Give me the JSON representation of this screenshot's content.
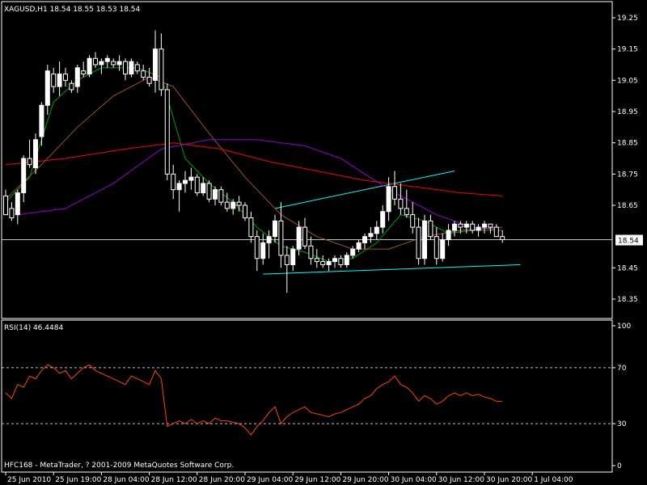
{
  "header": {
    "symbol_info": "XAGUSD,H1  18.54 18.55 18.53 18.54"
  },
  "indicator": {
    "label": "RSI(14) 46.4484"
  },
  "footer": {
    "copyright": "HFC168 - MetaTrader, ? 2001-2009 MetaQuotes Software Corp."
  },
  "current_price_label": "18.54",
  "colors": {
    "background": "#000000",
    "frame": "#ffffff",
    "bull_candle": "#ffffff",
    "bear_candle": "#000000",
    "ma_fast": "#00a000",
    "ma_mid": "#a0522d",
    "ma_slow": "#ff0000",
    "ma_long": "#9400d3",
    "trendline": "#00ffff",
    "rsi_line": "#ff4500",
    "level_line": "#c0c0c0"
  },
  "chart_data": [
    {
      "type": "candlestick",
      "title": "XAGUSD,H1  18.54 18.55 18.53 18.54",
      "ylim": [
        18.3,
        19.3
      ],
      "y_ticks": [
        "19.25",
        "19.15",
        "19.05",
        "18.95",
        "18.85",
        "18.75",
        "18.65",
        "18.54",
        "18.45",
        "18.35"
      ],
      "y_tick_values": [
        19.25,
        19.15,
        19.05,
        18.95,
        18.85,
        18.75,
        18.65,
        18.54,
        18.45,
        18.35
      ],
      "x_ticks": [
        "25 Jun 2010",
        "25 Jun 19:00",
        "28 Jun 04:00",
        "28 Jun 12:00",
        "28 Jun 20:00",
        "29 Jun 04:00",
        "29 Jun 12:00",
        "29 Jun 20:00",
        "30 Jun 04:00",
        "30 Jun 12:00",
        "30 Jun 20:00",
        "1 Jul 04:00"
      ],
      "x_tick_index": [
        0,
        8,
        16,
        24,
        32,
        40,
        48,
        56,
        64,
        72,
        80,
        88
      ],
      "current_price": 18.54,
      "ohlc": [
        [
          18.68,
          18.7,
          18.62,
          18.62
        ],
        [
          18.64,
          18.66,
          18.6,
          18.61
        ],
        [
          18.62,
          18.7,
          18.59,
          18.69
        ],
        [
          18.69,
          18.81,
          18.66,
          18.8
        ],
        [
          18.8,
          18.86,
          18.77,
          18.78
        ],
        [
          18.77,
          18.88,
          18.75,
          18.86
        ],
        [
          18.87,
          18.98,
          18.84,
          18.97
        ],
        [
          18.97,
          19.1,
          18.94,
          19.08
        ],
        [
          19.07,
          19.09,
          19.01,
          19.03
        ],
        [
          19.03,
          19.11,
          19.0,
          19.07
        ],
        [
          19.07,
          19.09,
          19.03,
          19.05
        ],
        [
          19.04,
          19.05,
          19.01,
          19.02
        ],
        [
          19.03,
          19.1,
          19.01,
          19.09
        ],
        [
          19.08,
          19.11,
          19.06,
          19.07
        ],
        [
          19.07,
          19.13,
          19.06,
          19.12
        ],
        [
          19.12,
          19.14,
          19.09,
          19.1
        ],
        [
          19.1,
          19.12,
          19.07,
          19.11
        ],
        [
          19.11,
          19.13,
          19.09,
          19.12
        ],
        [
          19.11,
          19.12,
          19.09,
          19.1
        ],
        [
          19.1,
          19.13,
          19.08,
          19.11
        ],
        [
          19.11,
          19.12,
          19.05,
          19.07
        ],
        [
          19.07,
          19.12,
          19.06,
          19.11
        ],
        [
          19.1,
          19.11,
          19.07,
          19.08
        ],
        [
          19.08,
          19.1,
          19.05,
          19.06
        ],
        [
          19.06,
          19.09,
          19.03,
          19.04
        ],
        [
          19.05,
          19.21,
          19.01,
          19.15
        ],
        [
          19.15,
          19.2,
          19.0,
          19.02
        ],
        [
          19.02,
          19.04,
          18.73,
          18.75
        ],
        [
          18.75,
          18.78,
          18.67,
          18.7
        ],
        [
          18.7,
          18.73,
          18.63,
          18.72
        ],
        [
          18.72,
          18.76,
          18.69,
          18.73
        ],
        [
          18.73,
          18.77,
          18.7,
          18.74
        ],
        [
          18.74,
          18.75,
          18.68,
          18.69
        ],
        [
          18.69,
          18.74,
          18.68,
          18.72
        ],
        [
          18.72,
          18.73,
          18.66,
          18.67
        ],
        [
          18.67,
          18.71,
          18.65,
          18.7
        ],
        [
          18.7,
          18.71,
          18.65,
          18.66
        ],
        [
          18.66,
          18.69,
          18.63,
          18.64
        ],
        [
          18.64,
          18.67,
          18.62,
          18.66
        ],
        [
          18.66,
          18.68,
          18.63,
          18.65
        ],
        [
          18.65,
          18.66,
          18.6,
          18.61
        ],
        [
          18.61,
          18.63,
          18.53,
          18.55
        ],
        [
          18.55,
          18.57,
          18.44,
          18.48
        ],
        [
          18.48,
          18.56,
          18.46,
          18.53
        ],
        [
          18.53,
          18.57,
          18.48,
          18.55
        ],
        [
          18.55,
          18.62,
          18.53,
          18.6
        ],
        [
          18.6,
          18.66,
          18.45,
          18.49
        ],
        [
          18.49,
          18.52,
          18.37,
          18.46
        ],
        [
          18.46,
          18.52,
          18.44,
          18.51
        ],
        [
          18.51,
          18.6,
          18.49,
          18.58
        ],
        [
          18.58,
          18.61,
          18.51,
          18.52
        ],
        [
          18.52,
          18.55,
          18.46,
          18.48
        ],
        [
          18.48,
          18.51,
          18.45,
          18.47
        ],
        [
          18.47,
          18.49,
          18.45,
          18.46
        ],
        [
          18.46,
          18.48,
          18.44,
          18.47
        ],
        [
          18.47,
          18.49,
          18.45,
          18.48
        ],
        [
          18.48,
          18.49,
          18.45,
          18.46
        ],
        [
          18.46,
          18.5,
          18.45,
          18.49
        ],
        [
          18.49,
          18.52,
          18.48,
          18.51
        ],
        [
          18.51,
          18.54,
          18.5,
          18.53
        ],
        [
          18.53,
          18.56,
          18.51,
          18.55
        ],
        [
          18.55,
          18.58,
          18.53,
          18.56
        ],
        [
          18.56,
          18.6,
          18.54,
          18.58
        ],
        [
          18.58,
          18.65,
          18.56,
          18.63
        ],
        [
          18.63,
          18.74,
          18.6,
          18.71
        ],
        [
          18.71,
          18.76,
          18.65,
          18.67
        ],
        [
          18.67,
          18.72,
          18.62,
          18.64
        ],
        [
          18.64,
          18.7,
          18.61,
          18.62
        ],
        [
          18.62,
          18.66,
          18.56,
          18.58
        ],
        [
          18.58,
          18.61,
          18.46,
          18.48
        ],
        [
          18.48,
          18.62,
          18.46,
          18.6
        ],
        [
          18.6,
          18.62,
          18.54,
          18.55
        ],
        [
          18.55,
          18.58,
          18.46,
          18.48
        ],
        [
          18.48,
          18.56,
          18.47,
          18.54
        ],
        [
          18.54,
          18.59,
          18.52,
          18.57
        ],
        [
          18.57,
          18.6,
          18.55,
          18.59
        ],
        [
          18.59,
          18.6,
          18.56,
          18.58
        ],
        [
          18.58,
          18.6,
          18.56,
          18.59
        ],
        [
          18.59,
          18.6,
          18.56,
          18.57
        ],
        [
          18.57,
          18.59,
          18.55,
          18.58
        ],
        [
          18.58,
          18.6,
          18.56,
          18.59
        ],
        [
          18.59,
          18.59,
          18.56,
          18.58
        ],
        [
          18.58,
          18.59,
          18.55,
          18.55
        ],
        [
          18.55,
          18.57,
          18.53,
          18.54
        ]
      ],
      "moving_averages": [
        {
          "key": "ma_fast",
          "points": [
            [
              0,
              18.66
            ],
            [
              4,
              18.74
            ],
            [
              8,
              18.98
            ],
            [
              12,
              19.05
            ],
            [
              16,
              19.09
            ],
            [
              22,
              19.09
            ],
            [
              26,
              19.06
            ],
            [
              30,
              18.8
            ],
            [
              34,
              18.72
            ],
            [
              38,
              18.66
            ],
            [
              42,
              18.58
            ],
            [
              46,
              18.52
            ],
            [
              50,
              18.5
            ],
            [
              54,
              18.47
            ],
            [
              58,
              18.48
            ],
            [
              62,
              18.53
            ],
            [
              66,
              18.62
            ],
            [
              70,
              18.6
            ],
            [
              74,
              18.56
            ],
            [
              78,
              18.57
            ],
            [
              83,
              18.57
            ]
          ]
        },
        {
          "key": "ma_mid",
          "points": [
            [
              0,
              18.67
            ],
            [
              6,
              18.78
            ],
            [
              12,
              18.9
            ],
            [
              18,
              19.0
            ],
            [
              24,
              19.06
            ],
            [
              28,
              19.03
            ],
            [
              34,
              18.88
            ],
            [
              40,
              18.74
            ],
            [
              46,
              18.62
            ],
            [
              52,
              18.55
            ],
            [
              58,
              18.51
            ],
            [
              64,
              18.51
            ],
            [
              70,
              18.55
            ],
            [
              76,
              18.57
            ],
            [
              83,
              18.58
            ]
          ]
        },
        {
          "key": "ma_slow",
          "points": [
            [
              0,
              18.78
            ],
            [
              10,
              18.8
            ],
            [
              20,
              18.83
            ],
            [
              28,
              18.85
            ],
            [
              36,
              18.83
            ],
            [
              44,
              18.79
            ],
            [
              52,
              18.76
            ],
            [
              60,
              18.73
            ],
            [
              68,
              18.71
            ],
            [
              76,
              18.69
            ],
            [
              83,
              18.68
            ]
          ]
        },
        {
          "key": "ma_long",
          "points": [
            [
              2,
              18.62
            ],
            [
              10,
              18.64
            ],
            [
              18,
              18.72
            ],
            [
              26,
              18.83
            ],
            [
              34,
              18.86
            ],
            [
              42,
              18.86
            ],
            [
              50,
              18.84
            ],
            [
              56,
              18.8
            ],
            [
              60,
              18.75
            ],
            [
              66,
              18.68
            ],
            [
              72,
              18.62
            ],
            [
              78,
              18.58
            ],
            [
              83,
              18.57
            ]
          ]
        }
      ],
      "trendlines": [
        {
          "points": [
            [
              45,
              18.64
            ],
            [
              75,
              18.76
            ]
          ]
        },
        {
          "points": [
            [
              43,
              18.43
            ],
            [
              86,
              18.46
            ]
          ]
        }
      ]
    },
    {
      "type": "line",
      "title": "RSI(14) 46.4484",
      "ylim": [
        0,
        100
      ],
      "y_ticks": [
        "100",
        "70",
        "30",
        "0"
      ],
      "y_tick_values": [
        100,
        70,
        30,
        0
      ],
      "levels": [
        70,
        30
      ],
      "values": [
        52,
        48,
        58,
        56,
        64,
        62,
        68,
        72,
        70,
        66,
        68,
        62,
        66,
        70,
        72,
        68,
        66,
        64,
        62,
        60,
        58,
        64,
        62,
        60,
        58,
        68,
        62,
        28,
        30,
        32,
        30,
        33,
        30,
        32,
        30,
        34,
        32,
        32,
        31,
        30,
        27,
        22,
        28,
        32,
        38,
        42,
        30,
        35,
        38,
        40,
        42,
        38,
        37,
        36,
        35,
        37,
        38,
        40,
        42,
        44,
        48,
        50,
        55,
        58,
        60,
        64,
        58,
        56,
        52,
        46,
        50,
        48,
        44,
        46,
        50,
        52,
        50,
        52,
        50,
        51,
        49,
        48,
        46,
        46
      ]
    }
  ]
}
